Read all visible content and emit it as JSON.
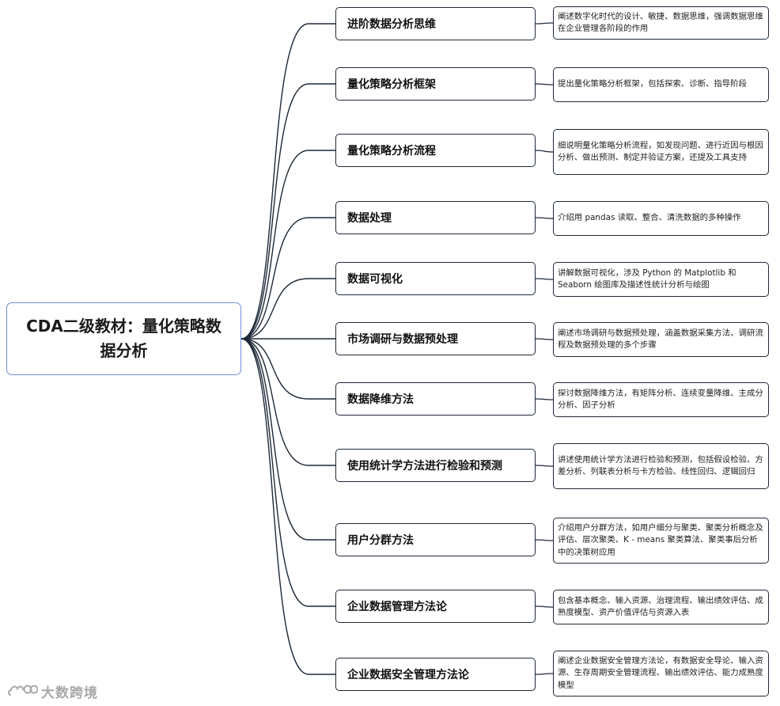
{
  "root": {
    "title": "CDA二级教材：量化策略数据分析"
  },
  "branches": [
    {
      "label": "进阶数据分析思维",
      "desc": "阐述数字化时代的设计、敏捷、数据思维，强调数据思维在企业管理各阶段的作用"
    },
    {
      "label": "量化策略分析框架",
      "desc": "提出量化策略分析框架，包括探索、诊断、指导阶段"
    },
    {
      "label": "量化策略分析流程",
      "desc": "细说明量化策略分析流程，如发现问题、进行近因与根因分析、做出预测、制定并验证方案，还提及工具支持"
    },
    {
      "label": "数据处理",
      "desc": "介绍用 pandas 读取、整合、清洗数据的多种操作"
    },
    {
      "label": "数据可视化",
      "desc": "讲解数据可视化，涉及 Python 的 Matplotlib 和 Seaborn 绘图库及描述性统计分析与绘图"
    },
    {
      "label": "市场调研与数据预处理",
      "desc": "阐述市场调研与数据预处理，涵盖数据采集方法、调研流程及数据预处理的多个步骤"
    },
    {
      "label": "数据降维方法",
      "desc": "探讨数据降维方法，有矩阵分析、连续变量降维、主成分分析、因子分析"
    },
    {
      "label": "使用统计学方法进行检验和预测",
      "desc": "讲述使用统计学方法进行检验和预测，包括假设检验、方差分析、列联表分析与卡方检验、线性回归、逻辑回归"
    },
    {
      "label": "用户分群方法",
      "desc": "介绍用户分群方法，如用户细分与聚类、聚类分析概念及评估、层次聚类、K - means 聚类算法、聚类事后分析中的决策树应用"
    },
    {
      "label": "企业数据管理方法论",
      "desc": "包含基本概念、输入资源、治理流程、输出绩效评估、成熟度模型、资产价值评估与资源入表"
    },
    {
      "label": "企业数据安全管理方法论",
      "desc": "阐述企业数据安全管理方法论，有数据安全导论、输入资源、生存周期安全管理流程、输出绩效评估、能力成熟度模型"
    }
  ],
  "watermark": {
    "text": "大数跨境",
    "icon": "cloud-logo-icon"
  },
  "colors": {
    "root_border": "#6f8fd6",
    "node_border": "#1e2a38",
    "connector": "#1e2a38",
    "watermark": "#a9a9a9"
  }
}
